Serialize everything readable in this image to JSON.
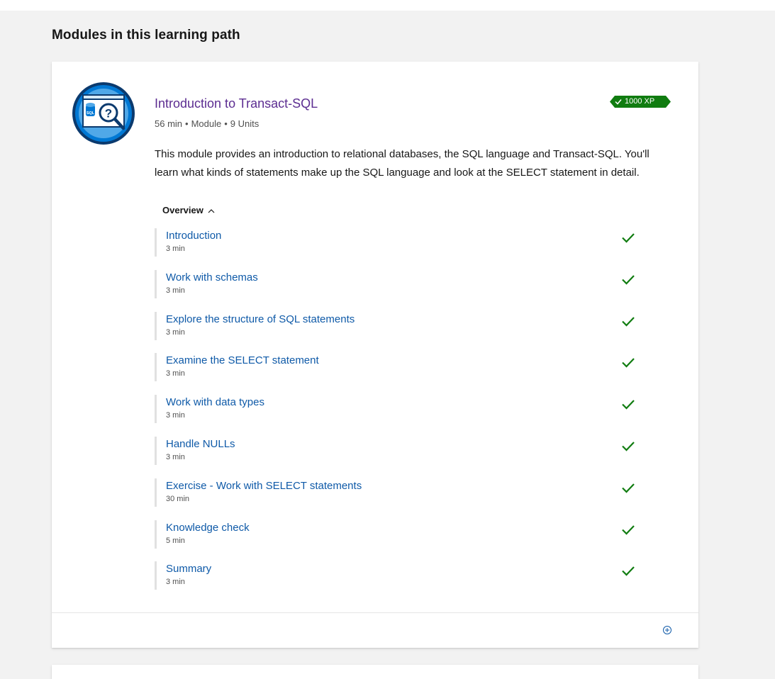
{
  "section": {
    "title": "Modules in this learning path"
  },
  "module": {
    "title": "Introduction to Transact-SQL",
    "duration": "56 min",
    "type": "Module",
    "units_count": "9 Units",
    "xp": "1000 XP",
    "description": "This module provides an introduction to relational databases, the SQL language and Transact-SQL. You'll learn what kinds of statements make up the SQL language and look at the SELECT statement in detail.",
    "overview_label": "Overview",
    "icon_text": "SQL",
    "units": [
      {
        "title": "Introduction",
        "duration": "3 min",
        "completed": true
      },
      {
        "title": "Work with schemas",
        "duration": "3 min",
        "completed": true
      },
      {
        "title": "Explore the structure of SQL statements",
        "duration": "3 min",
        "completed": true
      },
      {
        "title": "Examine the SELECT statement",
        "duration": "3 min",
        "completed": true
      },
      {
        "title": "Work with data types",
        "duration": "3 min",
        "completed": true
      },
      {
        "title": "Handle NULLs",
        "duration": "3 min",
        "completed": true
      },
      {
        "title": "Exercise - Work with SELECT statements",
        "duration": "30 min",
        "completed": true
      },
      {
        "title": "Knowledge check",
        "duration": "5 min",
        "completed": true
      },
      {
        "title": "Summary",
        "duration": "3 min",
        "completed": true
      }
    ]
  },
  "colors": {
    "title_link": "#5c2d91",
    "unit_link": "#0f5aa8",
    "check": "#107c10",
    "xp_badge": "#107c10",
    "add_icon": "#0f5aa8"
  },
  "icons": {
    "check": "checkmark-icon",
    "add": "circle-plus-icon",
    "chevron": "chevron-up-icon"
  }
}
